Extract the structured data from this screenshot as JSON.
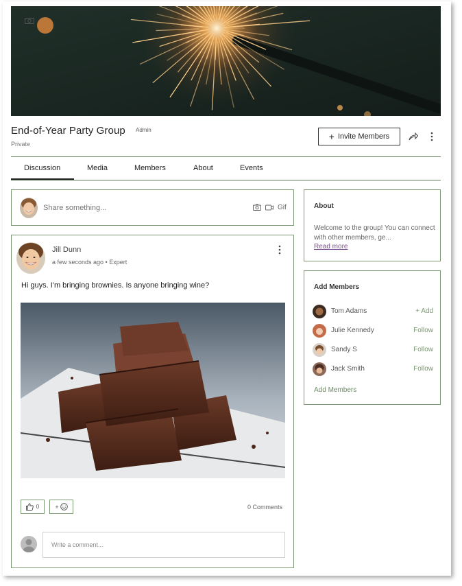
{
  "group": {
    "title": "End-of-Year Party Group",
    "role": "Admin",
    "privacy": "Private",
    "invite_label": "Invite Members"
  },
  "tabs": [
    {
      "label": "Discussion",
      "active": true
    },
    {
      "label": "Media"
    },
    {
      "label": "Members"
    },
    {
      "label": "About"
    },
    {
      "label": "Events"
    }
  ],
  "share": {
    "placeholder": "Share something...",
    "gif_label": "Gif"
  },
  "post": {
    "author": "Jill Dunn",
    "meta": "a few seconds ago • Expert",
    "text": "Hi guys. I'm bringing brownies. Is anyone bringing wine?",
    "likes": "0",
    "react_plus": "+",
    "comments_label": "0 Comments",
    "comment_placeholder": "Write a comment..."
  },
  "about": {
    "title": "About",
    "text": "Welcome to the group! You can connect with other members, ge...",
    "read_more": "Read more"
  },
  "add_members": {
    "title": "Add Members",
    "members": [
      {
        "name": "Tom Adams",
        "action": "+ Add"
      },
      {
        "name": "Julie Kennedy",
        "action": "Follow"
      },
      {
        "name": "Sandy S",
        "action": "Follow"
      },
      {
        "name": "Jack Smith",
        "action": "Follow"
      }
    ],
    "link": "Add Members"
  },
  "colors": {
    "accent": "#7a9871",
    "divider": "#5c7a55",
    "link": "#7a4b8a"
  },
  "icons": [
    "camera-icon",
    "share-icon",
    "more-icon",
    "photo-icon",
    "video-icon",
    "thumbs-up-icon",
    "smiley-icon",
    "plus-icon"
  ]
}
